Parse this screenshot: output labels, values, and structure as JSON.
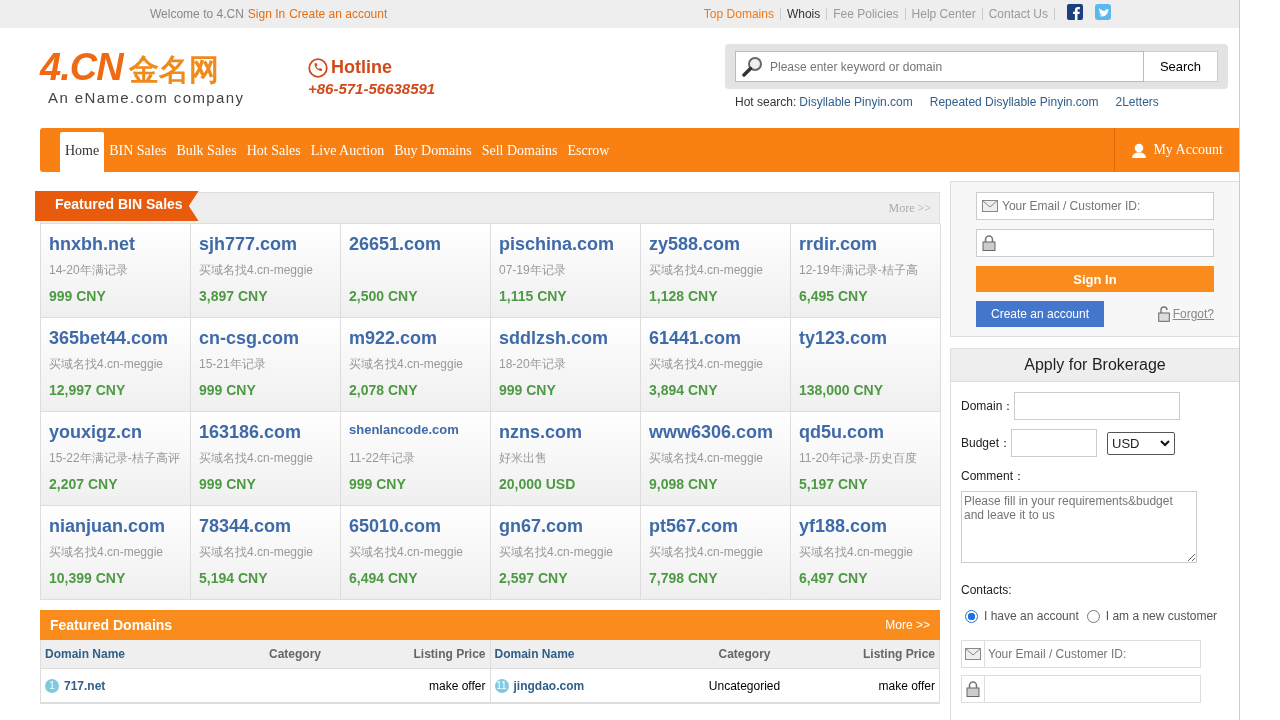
{
  "top_bar": {
    "welcome": "Welcome to 4.CN",
    "links": [
      {
        "label": "Sign In"
      },
      {
        "label": "Create an account"
      }
    ],
    "nav": [
      {
        "label": "Top Domains",
        "selected": true
      },
      {
        "label": "Whois",
        "selected": false
      },
      {
        "label": "Fee Policies",
        "selected": false
      },
      {
        "label": "Help Center",
        "selected": false
      },
      {
        "label": "Contact Us",
        "selected": false
      }
    ]
  },
  "logo": {
    "mark": "4.CN",
    "cn": "金名网",
    "tagline": "An eName.com company"
  },
  "hotline": {
    "label": "Hotline",
    "phone": "+86-571-56638591"
  },
  "search": {
    "placeholder": "Please enter keyword or domain",
    "button": "Search",
    "hot_label": "Hot search:",
    "hot": [
      "Disyllable Pinyin.com",
      "Repeated Disyllable Pinyin.com",
      "2Letters"
    ]
  },
  "main_nav": {
    "items": [
      {
        "label": "Home",
        "selected": true
      },
      {
        "label": "BIN Sales",
        "selected": false
      },
      {
        "label": "Bulk Sales",
        "selected": false
      },
      {
        "label": "Hot Sales",
        "selected": false
      },
      {
        "label": "Live Auction",
        "selected": false
      },
      {
        "label": "Buy Domains",
        "selected": false
      },
      {
        "label": "Sell Domains",
        "selected": false
      },
      {
        "label": "Escrow",
        "selected": false
      }
    ],
    "account": "My Account"
  },
  "bin_sales": {
    "title": "Featured BIN Sales",
    "more": "More >>",
    "items": [
      {
        "domain": "hnxbh.net",
        "note": "14-20年满记录",
        "price": "999 CNY"
      },
      {
        "domain": "sjh777.com",
        "note": "买域名找4.cn-meggie",
        "price": "3,897 CNY"
      },
      {
        "domain": "26651.com",
        "price": "2,500 CNY"
      },
      {
        "domain": "pischina.com",
        "note": "07-19年记录",
        "price": "1,115 CNY"
      },
      {
        "domain": "zy588.com",
        "note": "买域名找4.cn-meggie",
        "price": "1,128 CNY"
      },
      {
        "domain": "rrdir.com",
        "note": "12-19年满记录-桔子高",
        "price": "6,495 CNY"
      },
      {
        "domain": "365bet44.com",
        "note": "买域名找4.cn-meggie",
        "price": "12,997 CNY"
      },
      {
        "domain": "cn-csg.com",
        "note": "15-21年记录",
        "price": "999 CNY"
      },
      {
        "domain": "m922.com",
        "note": "买域名找4.cn-meggie",
        "price": "2,078 CNY"
      },
      {
        "domain": "sddlzsh.com",
        "note": "18-20年记录",
        "price": "999 CNY"
      },
      {
        "domain": "61441.com",
        "note": "买域名找4.cn-meggie",
        "price": "3,894 CNY"
      },
      {
        "domain": "ty123.com",
        "price": "138,000 CNY"
      },
      {
        "domain": "youxigz.cn",
        "note": "15-22年满记录-桔子高评",
        "price": "2,207 CNY"
      },
      {
        "domain": "163186.com",
        "note": "买域名找4.cn-meggie",
        "price": "999 CNY"
      },
      {
        "domain": "shenlancode.com",
        "note": "11-22年记录",
        "price": "999 CNY",
        "small": true
      },
      {
        "domain": "nzns.com",
        "note": "好米出售",
        "price": "20,000 USD"
      },
      {
        "domain": "www6306.com",
        "note": "买域名找4.cn-meggie",
        "price": "9,098 CNY"
      },
      {
        "domain": "qd5u.com",
        "note": "11-20年记录-历史百度",
        "price": "5,197 CNY"
      },
      {
        "domain": "nianjuan.com",
        "note": "买域名找4.cn-meggie",
        "price": "10,399 CNY"
      },
      {
        "domain": "78344.com",
        "note": "买域名找4.cn-meggie",
        "price": "5,194 CNY"
      },
      {
        "domain": "65010.com",
        "note": "买域名找4.cn-meggie",
        "price": "6,494 CNY"
      },
      {
        "domain": "gn67.com",
        "note": "买域名找4.cn-meggie",
        "price": "2,597 CNY"
      },
      {
        "domain": "pt567.com",
        "note": "买域名找4.cn-meggie",
        "price": "7,798 CNY"
      },
      {
        "domain": "yf188.com",
        "note": "买域名找4.cn-meggie",
        "price": "6,497 CNY"
      }
    ]
  },
  "featured_domains": {
    "title": "Featured Domains",
    "more": "More >>",
    "tables": [
      {
        "columns": [
          "Domain Name",
          "Category",
          "Listing Price"
        ],
        "rows": [
          {
            "rank": "1",
            "domain": "717.net",
            "price": "make offer"
          }
        ]
      },
      {
        "columns": [
          "Domain Name",
          "Category",
          "Listing Price"
        ],
        "rows": [
          {
            "rank": "11",
            "domain": "jingdao.com",
            "category": "Uncategoried",
            "price": "make offer"
          }
        ]
      }
    ]
  },
  "login": {
    "email_placeholder": "Your Email / Customer ID:",
    "sign_in": "Sign In",
    "create": "Create an account",
    "forgot": "Forgot?"
  },
  "brokerage": {
    "title": "Apply for Brokerage",
    "domain_label": "Domain：",
    "budget_label": "Budget：",
    "currency": "USD",
    "comment_label": "Comment：",
    "comment_placeholder": "Please fill in your requirements&budget and leave it to us",
    "contacts_label": "Contacts:",
    "options": [
      {
        "label": "I have an account",
        "selected": true
      },
      {
        "label": "I am a new customer",
        "selected": false
      }
    ],
    "email_placeholder": "Your Email / Customer ID:"
  }
}
